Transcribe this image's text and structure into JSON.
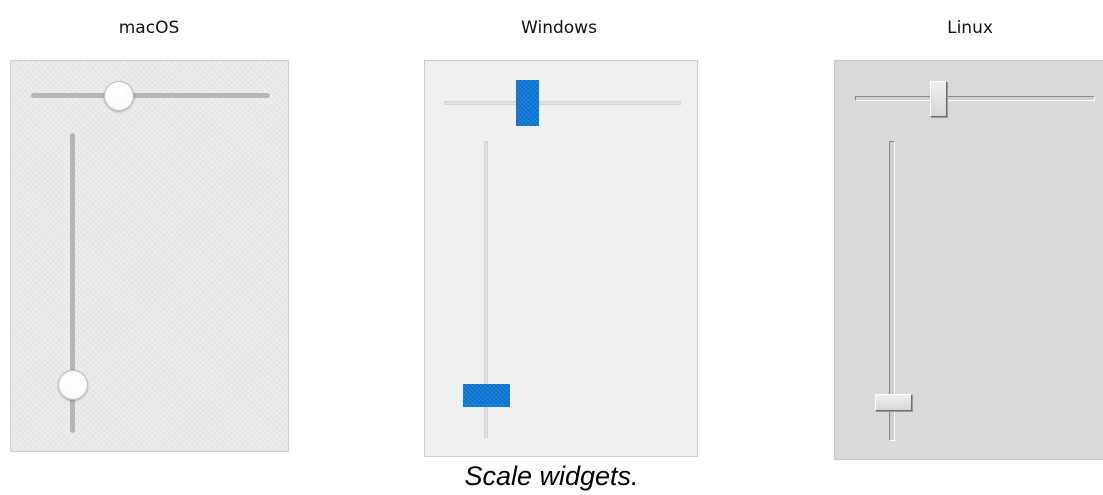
{
  "labels": {
    "macos": "macOS",
    "windows": "Windows",
    "linux": "Linux"
  },
  "caption": "Scale widgets.",
  "widgets": {
    "macos": {
      "horizontal_value_fraction": 0.35,
      "vertical_value_fraction": 0.84,
      "colors": {
        "panel": "#ececec",
        "track": "#b5b5b5",
        "knob": "#ffffff"
      }
    },
    "windows": {
      "horizontal_value_fraction": 0.33,
      "vertical_value_fraction": 0.86,
      "colors": {
        "panel": "#f0f0f0",
        "track": "#e2e2e2",
        "thumb": "#0a78d8"
      }
    },
    "linux": {
      "horizontal_value_fraction": 0.33,
      "vertical_value_fraction": 0.87,
      "colors": {
        "panel": "#d9d9d9",
        "track": "#cfcfcf",
        "thumb": "#e4e4e4"
      }
    }
  }
}
